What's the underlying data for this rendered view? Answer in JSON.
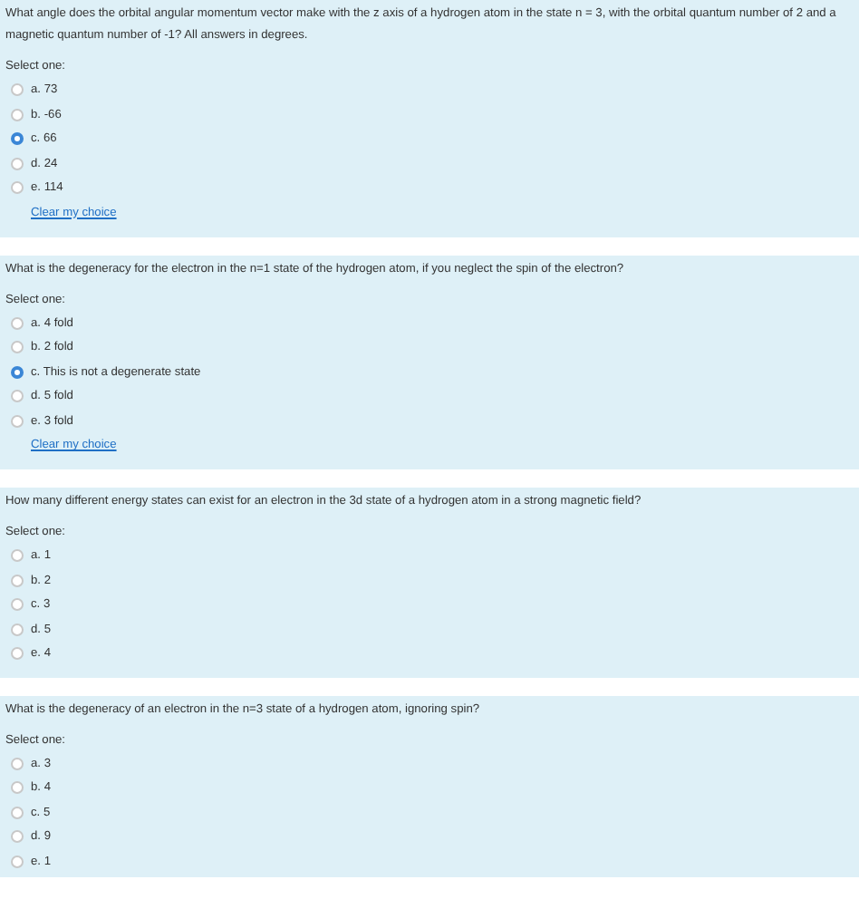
{
  "questions": [
    {
      "text": "What angle does the orbital angular momentum vector make with the z axis of a hydrogen atom in the state n = 3, with the orbital quantum number of 2 and a magnetic quantum number of -1? All answers in degrees.",
      "prompt": "Select one:",
      "options": [
        {
          "label": "a. 73",
          "selected": false
        },
        {
          "label": "b. -66",
          "selected": false
        },
        {
          "label": "c. 66",
          "selected": true
        },
        {
          "label": "d. 24",
          "selected": false
        },
        {
          "label": "e. 114",
          "selected": false
        }
      ],
      "clear_link": "Clear my choice"
    },
    {
      "text": "What is the degeneracy for the electron in the n=1 state of the hydrogen atom, if you neglect the spin of the electron?",
      "prompt": "Select one:",
      "options": [
        {
          "label": "a. 4 fold",
          "selected": false
        },
        {
          "label": "b. 2 fold",
          "selected": false
        },
        {
          "label": "c. This is not a degenerate state",
          "selected": true
        },
        {
          "label": "d. 5 fold",
          "selected": false
        },
        {
          "label": "e. 3 fold",
          "selected": false
        }
      ],
      "clear_link": "Clear my choice"
    },
    {
      "text": "How many different energy states can exist for an electron in the 3d state of a hydrogen atom in a strong magnetic field?",
      "prompt": "Select one:",
      "options": [
        {
          "label": "a. 1",
          "selected": false
        },
        {
          "label": "b. 2",
          "selected": false
        },
        {
          "label": "c. 3",
          "selected": false
        },
        {
          "label": "d. 5",
          "selected": false
        },
        {
          "label": "e. 4",
          "selected": false
        }
      ]
    },
    {
      "text": "What is the degeneracy of an electron in the n=3 state of a hydrogen atom, ignoring spin?",
      "prompt": "Select one:",
      "options": [
        {
          "label": "a. 3",
          "selected": false
        },
        {
          "label": "b. 4",
          "selected": false
        },
        {
          "label": "c. 5",
          "selected": false
        },
        {
          "label": "d. 9",
          "selected": false
        },
        {
          "label": "e. 1",
          "selected": false
        }
      ]
    }
  ]
}
